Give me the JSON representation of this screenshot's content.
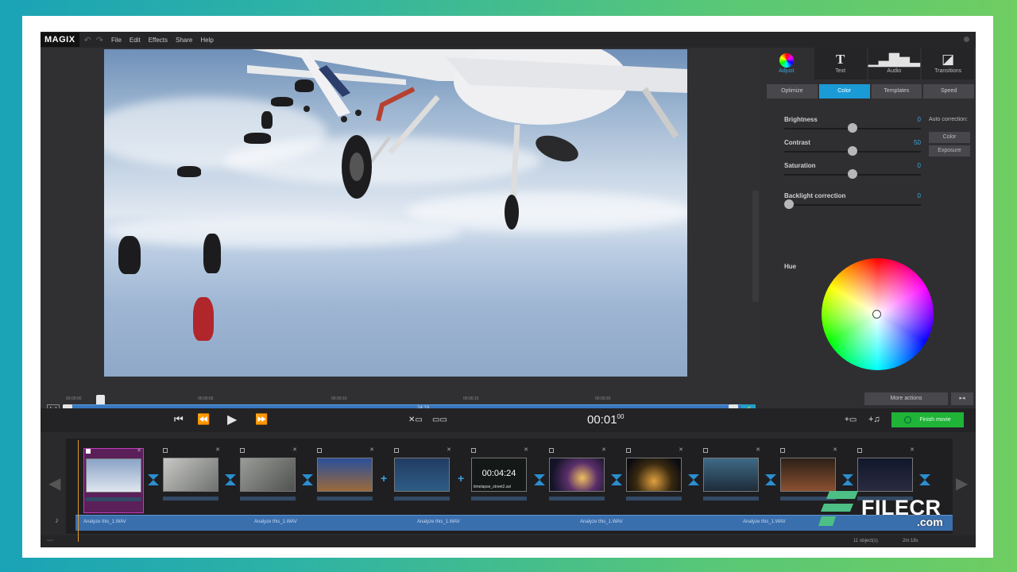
{
  "app": {
    "logo": "MAGIX",
    "menu": [
      "File",
      "Edit",
      "Effects",
      "Share",
      "Help"
    ]
  },
  "preview": {
    "scrub_label": "24:19",
    "ticks": [
      "00:00:00",
      "00:00:05",
      "00:00:10",
      "00:00:15",
      "00:00:20"
    ]
  },
  "panel": {
    "tabs": [
      {
        "label": "Adjust",
        "icon": "color-wheel-icon"
      },
      {
        "label": "Text",
        "icon": "text-T-icon"
      },
      {
        "label": "Audio",
        "icon": "waveform-icon"
      },
      {
        "label": "Transitions",
        "icon": "transition-icon"
      }
    ],
    "subtabs": [
      "Optimize",
      "Color",
      "Templates",
      "Speed"
    ],
    "active_subtab": "Color",
    "sliders": [
      {
        "label": "Brightness",
        "value": "0",
        "level": 0.5
      },
      {
        "label": "Contrast",
        "value": "50",
        "level": 0.5
      },
      {
        "label": "Saturation",
        "value": "0",
        "level": 0.5
      },
      {
        "label": "Backlight correction",
        "value": "0",
        "level": 0
      }
    ],
    "auto_label": "Auto correction:",
    "auto_buttons": [
      "Color",
      "Exposure"
    ],
    "hue_label": "Hue",
    "more_actions": "More actions",
    "more_arrow": "▸◂"
  },
  "transport": {
    "timecode": "00:01",
    "timecode_frames": "00",
    "finish_label": "Finish movie",
    "accent": "#1fb338"
  },
  "storyboard": {
    "clip_timecode": "00:04:24",
    "clip_name": "timelapse_street2.avi",
    "audio_labels": [
      "Analyze this_1.WAV",
      "Analyze this_1.WAV",
      "Analyze this_1.WAV",
      "Analyze this_1.WAV",
      "Analyze this_1.WAV"
    ],
    "status_objects": "11 object(s)",
    "status_duration": "2m:18s"
  },
  "watermark": {
    "text": "FILECR",
    "domain": ".com"
  }
}
